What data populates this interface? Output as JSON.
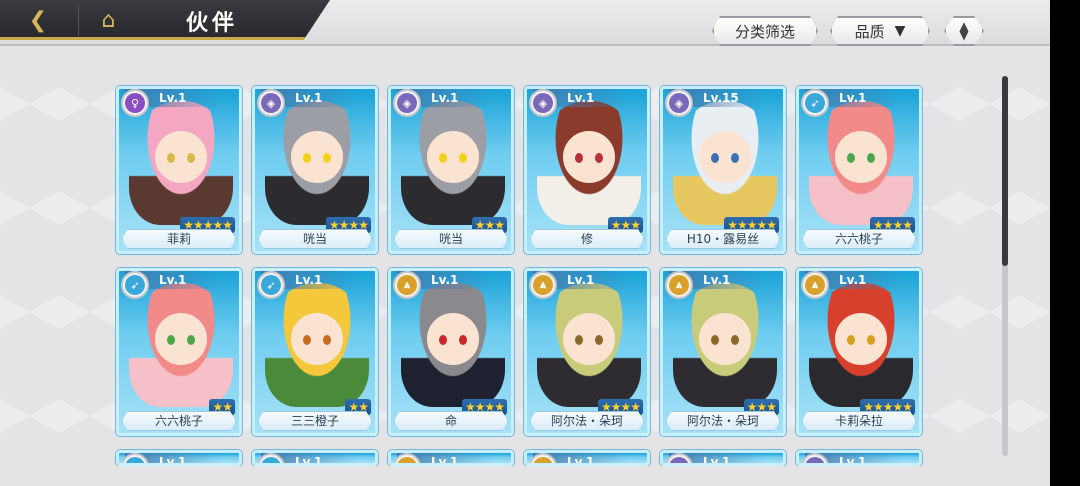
{
  "header": {
    "title": "伙伴",
    "filter_label": "分类筛选",
    "quality_label": "品质",
    "quality_caret": "▼",
    "sort_up": "▲",
    "sort_down": "▼"
  },
  "cards": [
    {
      "name": "菲莉",
      "level": "Lv.1",
      "stars": "★★★★★",
      "class": "purple",
      "class_icon": "♀",
      "hair": "#f4a6c2",
      "eye": "#d8b84a",
      "outfit": "#5a3a30"
    },
    {
      "name": "咣当",
      "level": "Lv.1",
      "stars": "★★★★",
      "class": "shield",
      "class_icon": "◈",
      "hair": "#9b9ea4",
      "eye": "#f2d218",
      "outfit": "#2c2c30"
    },
    {
      "name": "咣当",
      "level": "Lv.1",
      "stars": "★★★",
      "class": "shield",
      "class_icon": "◈",
      "hair": "#9b9ea4",
      "eye": "#f2d218",
      "outfit": "#2c2c30"
    },
    {
      "name": "修",
      "level": "Lv.1",
      "stars": "★★★",
      "class": "shield",
      "class_icon": "◈",
      "hair": "#8a3b2c",
      "eye": "#b8303a",
      "outfit": "#f2eee8"
    },
    {
      "name": "H10・露易丝",
      "level": "Lv.15",
      "stars": "★★★★★",
      "class": "shield",
      "class_icon": "◈",
      "hair": "#e8eef2",
      "eye": "#3a6fb8",
      "outfit": "#e7c860"
    },
    {
      "name": "六六桃子",
      "level": "Lv.1",
      "stars": "★★★★",
      "class": "bow",
      "class_icon": "➶",
      "hair": "#f28a8a",
      "eye": "#4aa84a",
      "outfit": "#f5c0c8"
    },
    {
      "name": "六六桃子",
      "level": "Lv.1",
      "stars": "★★",
      "class": "bow",
      "class_icon": "➶",
      "hair": "#f28a8a",
      "eye": "#4aa84a",
      "outfit": "#f5c0c8"
    },
    {
      "name": "三三橙子",
      "level": "Lv.1",
      "stars": "★★",
      "class": "bow",
      "class_icon": "➶",
      "hair": "#f4c83a",
      "eye": "#c86a20",
      "outfit": "#4a8a3a"
    },
    {
      "name": "命",
      "level": "Lv.1",
      "stars": "★★★★",
      "class": "gold",
      "class_icon": "⩓",
      "hair": "#8a8a8e",
      "eye": "#c8282a",
      "outfit": "#1e2230"
    },
    {
      "name": "阿尔法・朵珂",
      "level": "Lv.1",
      "stars": "★★★★",
      "class": "gold",
      "class_icon": "⩓",
      "hair": "#c8cc7a",
      "eye": "#8a6a2a",
      "outfit": "#2e2c30"
    },
    {
      "name": "阿尔法・朵珂",
      "level": "Lv.1",
      "stars": "★★★",
      "class": "gold",
      "class_icon": "⩓",
      "hair": "#c8cc7a",
      "eye": "#8a6a2a",
      "outfit": "#2e2c30"
    },
    {
      "name": "卡莉朵拉",
      "level": "Lv.1",
      "stars": "★★★★★",
      "class": "gold",
      "class_icon": "⩓",
      "hair": "#d8402e",
      "eye": "#d8a020",
      "outfit": "#2a2a2e"
    }
  ],
  "partial_row_levels": [
    "Lv.1",
    "Lv.1",
    "Lv.1",
    "Lv.1",
    "Lv.1",
    "Lv.1"
  ],
  "colors": {
    "card_top": "#1aa3d8",
    "star": "#ffd12e",
    "topbar": "#26272b",
    "accent_gold": "#c9a84a"
  }
}
